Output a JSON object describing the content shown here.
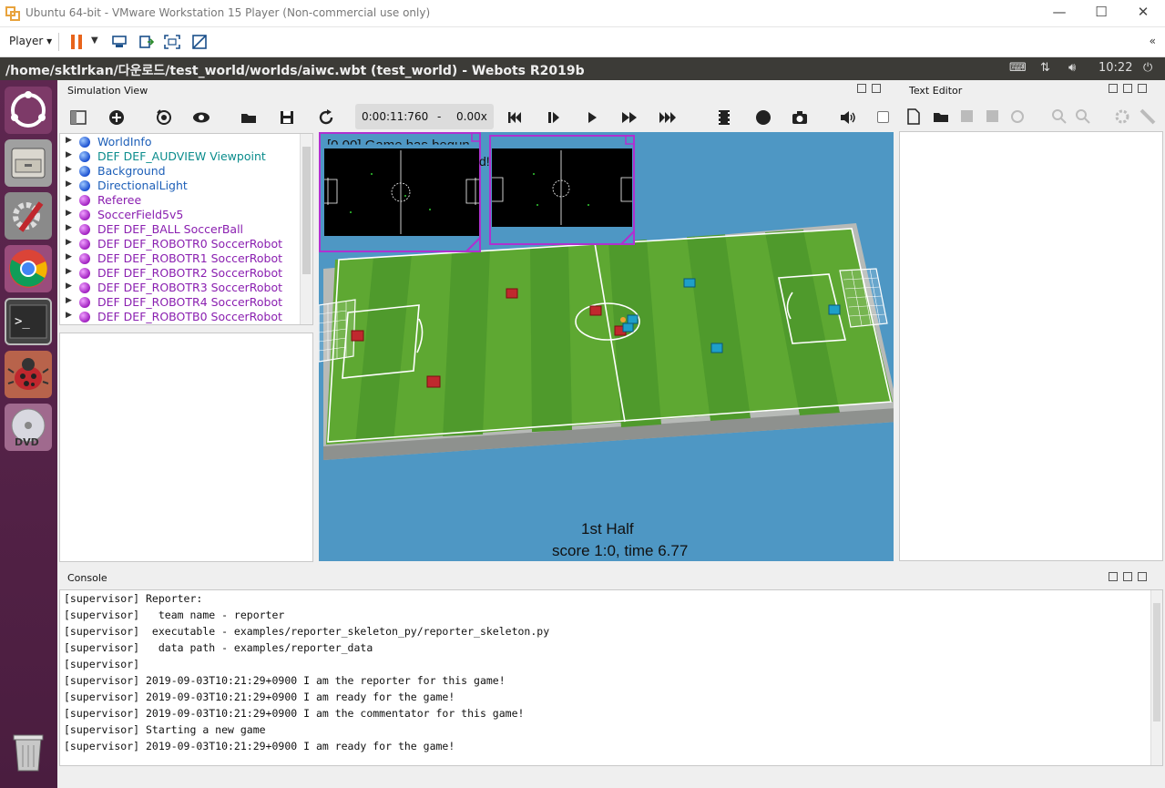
{
  "vm": {
    "title": "Ubuntu 64-bit - VMware Workstation 15 Player (Non-commercial use only)",
    "player_menu": "Player ▾",
    "collapse": "«"
  },
  "ubuntu": {
    "window_title": "/home/sktlrkan/다운로드/test_world/worlds/aiwc.wbt (test_world) - Webots R2019b",
    "clock": "10:22"
  },
  "sim_view": {
    "title": "Simulation View",
    "time": "0:00:11:760",
    "dash": "-",
    "speed": "0.00x"
  },
  "text_editor": {
    "title": "Text Editor"
  },
  "console": {
    "title": "Console",
    "lines": [
      "[supervisor] Reporter:",
      "[supervisor]   team name - reporter",
      "[supervisor]  executable - examples/reporter_skeleton_py/reporter_skeleton.py",
      "[supervisor]   data path - examples/reporter_data",
      "[supervisor]",
      "[supervisor] 2019-09-03T10:21:29+0900 I am the reporter for this game!",
      "[supervisor] 2019-09-03T10:21:29+0900 I am ready for the game!",
      "[supervisor] 2019-09-03T10:21:29+0900 I am the commentator for this game!",
      "[supervisor] Starting a new game",
      "[supervisor] 2019-09-03T10:21:29+0900 I am ready for the game!"
    ]
  },
  "scene_tree": [
    {
      "label": "WorldInfo",
      "dot": "blue",
      "color": "blue"
    },
    {
      "label": "DEF DEF_AUDVIEW Viewpoint",
      "dot": "blue",
      "color": "teal"
    },
    {
      "label": "Background",
      "dot": "blue",
      "color": "blue"
    },
    {
      "label": "DirectionalLight",
      "dot": "blue",
      "color": "blue"
    },
    {
      "label": "Referee",
      "dot": "purple",
      "color": "purple"
    },
    {
      "label": "SoccerField5v5",
      "dot": "purple",
      "color": "purple"
    },
    {
      "label": "DEF DEF_BALL SoccerBall",
      "dot": "purple",
      "color": "purple"
    },
    {
      "label": "DEF DEF_ROBOTR0 SoccerRobot",
      "dot": "purple",
      "color": "purple"
    },
    {
      "label": "DEF DEF_ROBOTR1 SoccerRobot",
      "dot": "purple",
      "color": "purple"
    },
    {
      "label": "DEF DEF_ROBOTR2 SoccerRobot",
      "dot": "purple",
      "color": "purple"
    },
    {
      "label": "DEF DEF_ROBOTR3 SoccerRobot",
      "dot": "purple",
      "color": "purple"
    },
    {
      "label": "DEF DEF_ROBOTR4 SoccerRobot",
      "dot": "purple",
      "color": "purple"
    },
    {
      "label": "DEF DEF_ROBOTB0 SoccerRobot",
      "dot": "purple",
      "color": "purple"
    }
  ],
  "overlay": {
    "game_msg": "[0.00] Game has begun",
    "game_msg_2": "d!",
    "half": "1st Half",
    "score": "score 1:0, time 6.77"
  },
  "colors": {
    "launcher": "#5e2750",
    "field_light": "#6ab53a",
    "field_dark": "#4f9a2c",
    "sky": "#4e97c4",
    "robot_red": "#c0282e",
    "robot_blue": "#1e9fc9"
  }
}
